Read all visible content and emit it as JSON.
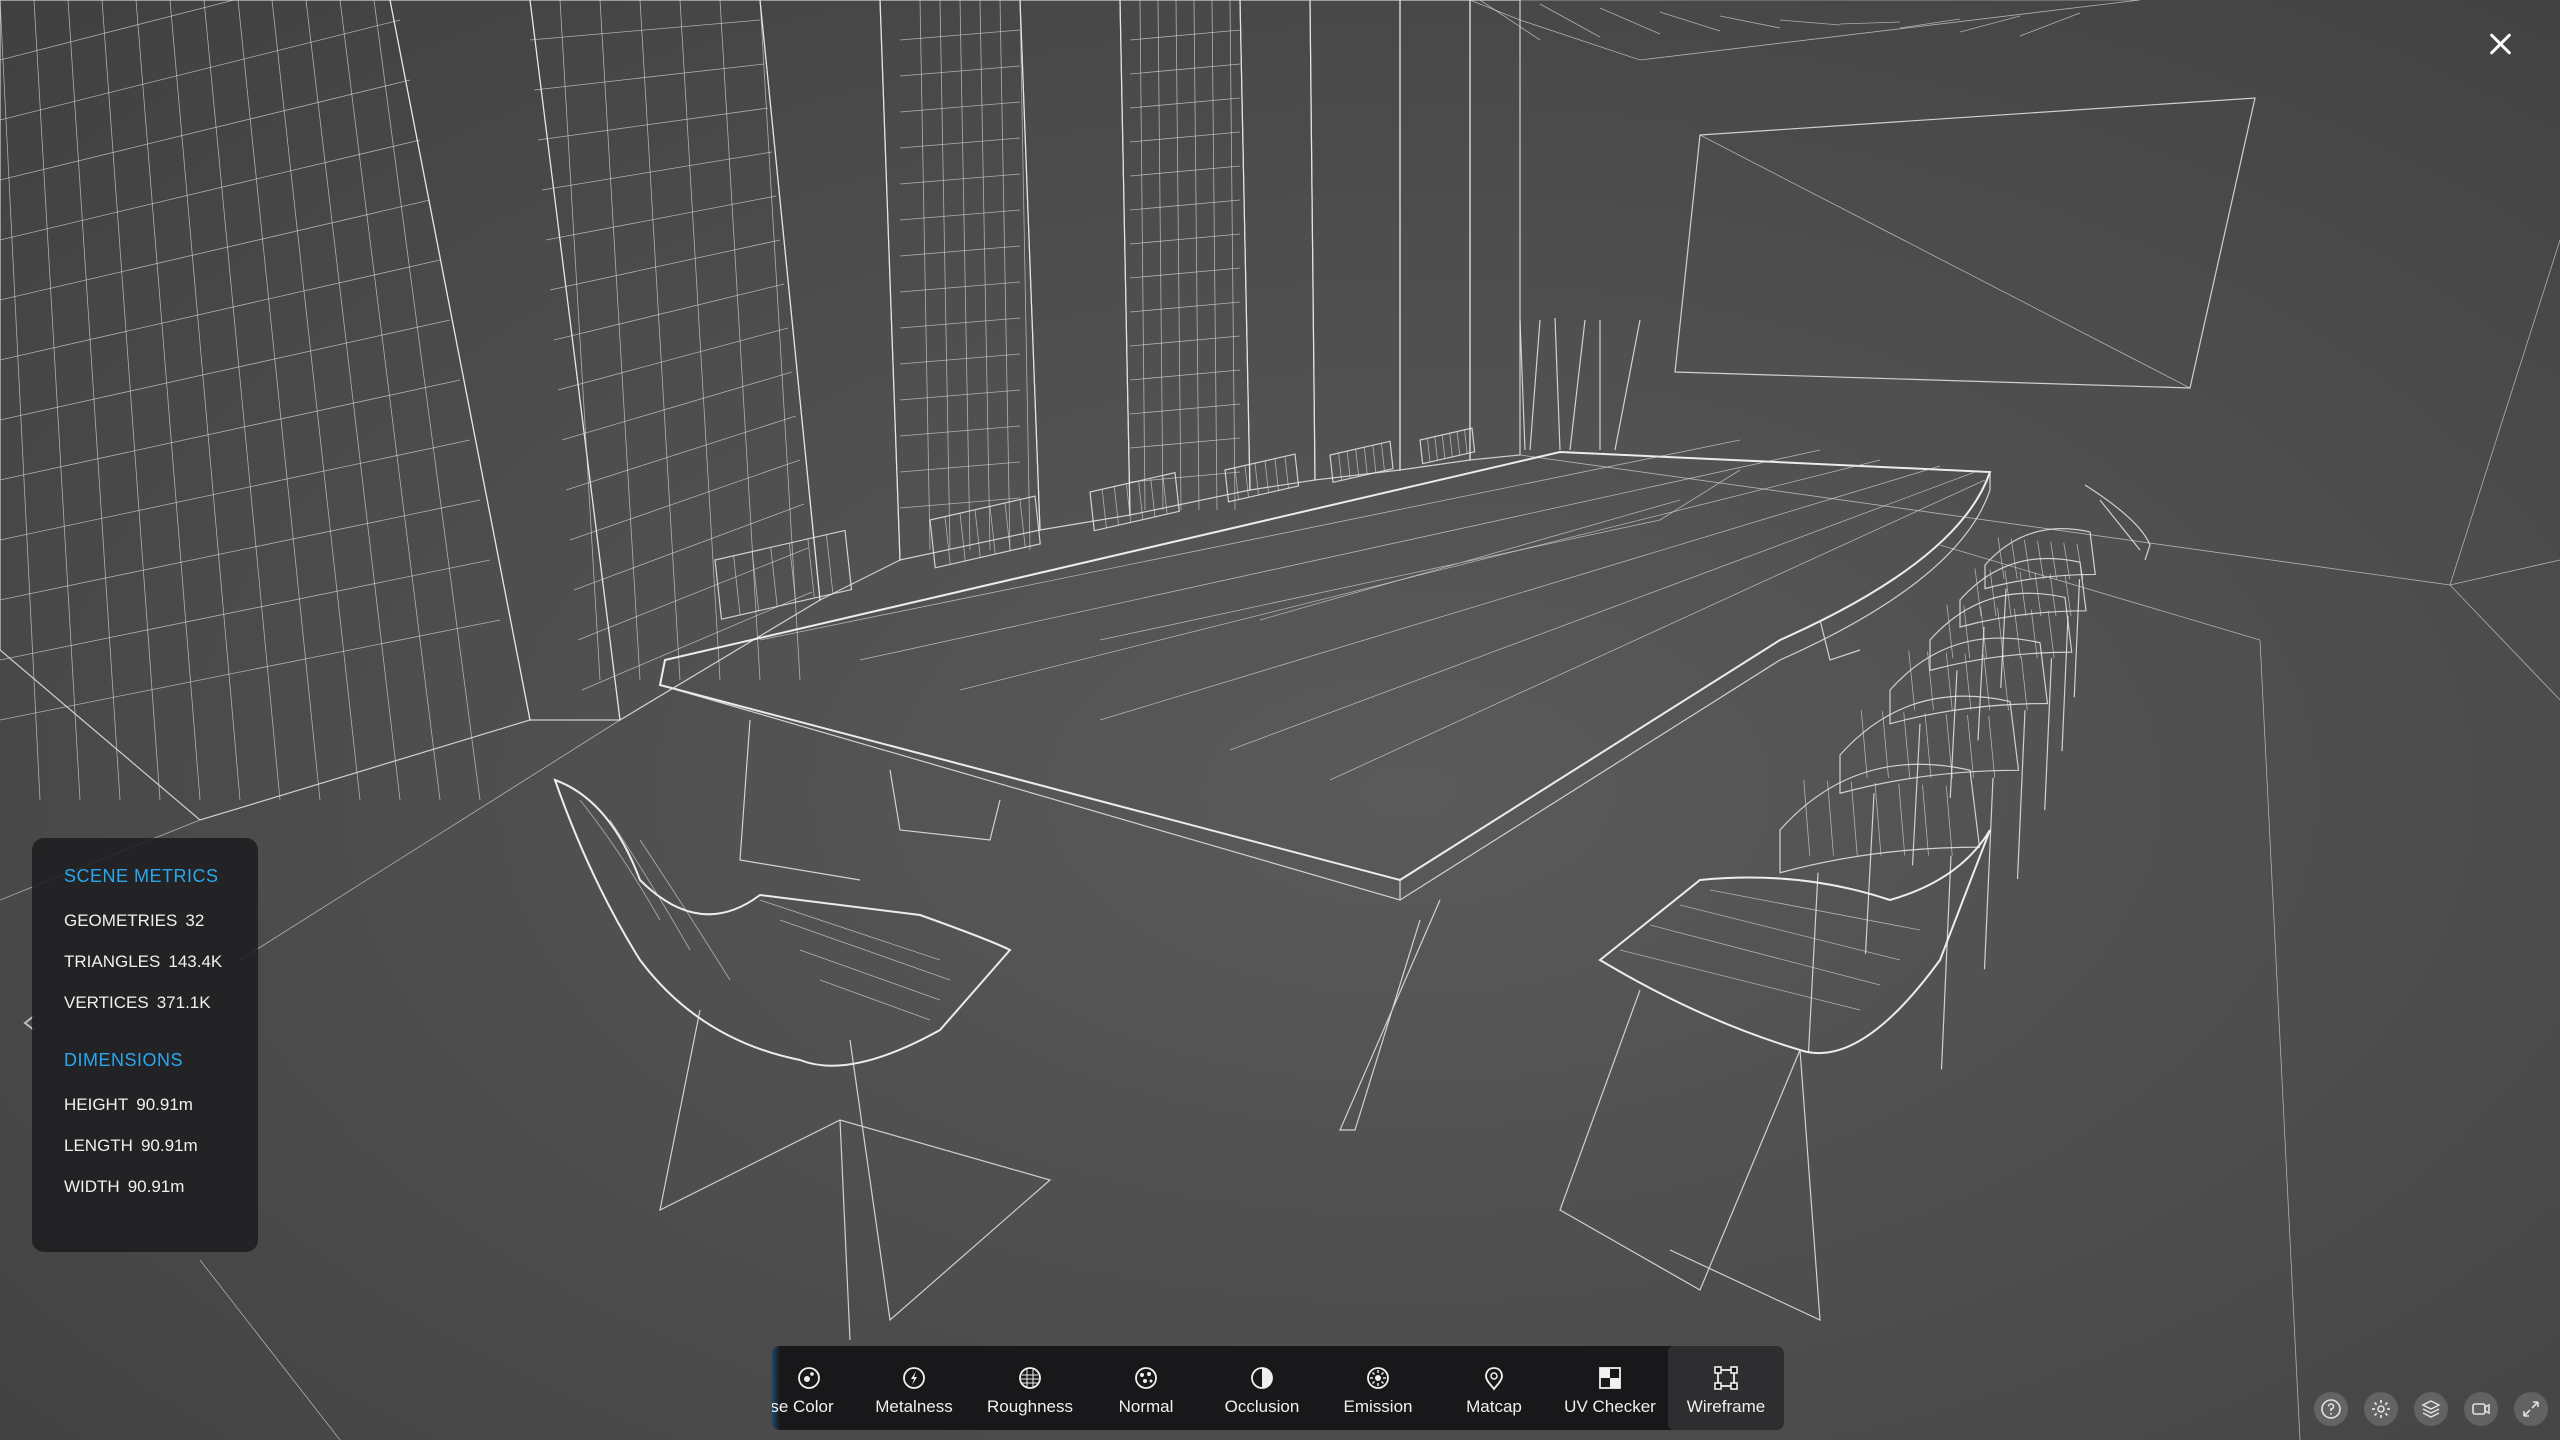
{
  "viewer": {
    "scene": "Conference room wireframe render"
  },
  "metrics_panel": {
    "scene_metrics_title": "SCENE METRICS",
    "geometries_label": "GEOMETRIES",
    "geometries_value": "32",
    "triangles_label": "TRIANGLES",
    "triangles_value": "143.4K",
    "vertices_label": "VERTICES",
    "vertices_value": "371.1K",
    "dimensions_title": "DIMENSIONS",
    "height_label": "HEIGHT",
    "height_value": "90.91m",
    "length_label": "LENGTH",
    "length_value": "90.91m",
    "width_label": "WIDTH",
    "width_value": "90.91m"
  },
  "toolbar": {
    "items": [
      {
        "label": "se Color",
        "icon": "base-color-icon"
      },
      {
        "label": "Metalness",
        "icon": "metalness-icon"
      },
      {
        "label": "Roughness",
        "icon": "roughness-icon"
      },
      {
        "label": "Normal",
        "icon": "normal-icon"
      },
      {
        "label": "Occlusion",
        "icon": "occlusion-icon"
      },
      {
        "label": "Emission",
        "icon": "emission-icon"
      },
      {
        "label": "Matcap",
        "icon": "matcap-icon"
      },
      {
        "label": "UV Checker",
        "icon": "uv-checker-icon"
      },
      {
        "label": "Wireframe",
        "icon": "wireframe-icon",
        "active": true
      }
    ]
  },
  "corner_controls": [
    "help-icon",
    "settings-icon",
    "layers-icon",
    "camera-icon",
    "fullscreen-icon"
  ],
  "colors": {
    "background": "#4d4d4d",
    "accent": "#29a8f0",
    "panel": "#1e1e20",
    "wire": "#e8e8e8"
  }
}
